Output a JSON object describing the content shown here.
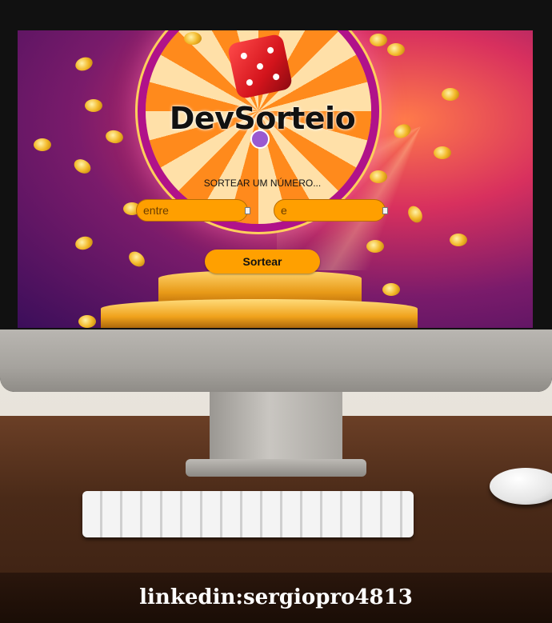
{
  "app": {
    "logo": "DevSorteio",
    "subtitle": "SORTEAR UM NÚMERO..."
  },
  "form": {
    "min_placeholder": "entre",
    "max_placeholder": "e",
    "submit_label": "Sortear"
  },
  "caption": "linkedin:sergiopro4813",
  "colors": {
    "button": "#ffa000",
    "field": "#ff9f00",
    "screen_bg": "#7a1b6b"
  },
  "icons": {
    "decoration": [
      "dice-icon",
      "wheel-of-fortune",
      "coins",
      "podium"
    ]
  }
}
